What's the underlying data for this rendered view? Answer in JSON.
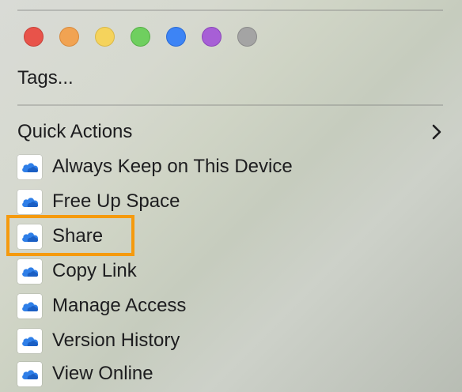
{
  "tag_colors": [
    {
      "name": "red",
      "fill": "#e8534a",
      "border": "#c8423a"
    },
    {
      "name": "orange",
      "fill": "#f1a352",
      "border": "#d88a3c"
    },
    {
      "name": "yellow",
      "fill": "#f5d35c",
      "border": "#d9b848"
    },
    {
      "name": "green",
      "fill": "#6fcf5f",
      "border": "#55b046"
    },
    {
      "name": "blue",
      "fill": "#3d84f5",
      "border": "#2a6bd6"
    },
    {
      "name": "purple",
      "fill": "#a75fd6",
      "border": "#8b47ba"
    },
    {
      "name": "gray",
      "fill": "#a4a4a4",
      "border": "#8a8a8a"
    }
  ],
  "tags_label": "Tags...",
  "quick_actions": {
    "label": "Quick Actions",
    "chevron_icon": "chevron-right-icon",
    "items": [
      {
        "label": "Always Keep on This Device",
        "icon": "onedrive-cloud-icon"
      },
      {
        "label": "Free Up Space",
        "icon": "onedrive-cloud-icon"
      },
      {
        "label": "Share",
        "icon": "onedrive-cloud-icon"
      },
      {
        "label": "Copy Link",
        "icon": "onedrive-cloud-icon"
      },
      {
        "label": "Manage Access",
        "icon": "onedrive-cloud-icon"
      },
      {
        "label": "Version History",
        "icon": "onedrive-cloud-icon"
      },
      {
        "label": "View Online",
        "icon": "onedrive-cloud-icon"
      }
    ]
  },
  "highlight": {
    "target": "Share",
    "color": "#f59a0e"
  }
}
